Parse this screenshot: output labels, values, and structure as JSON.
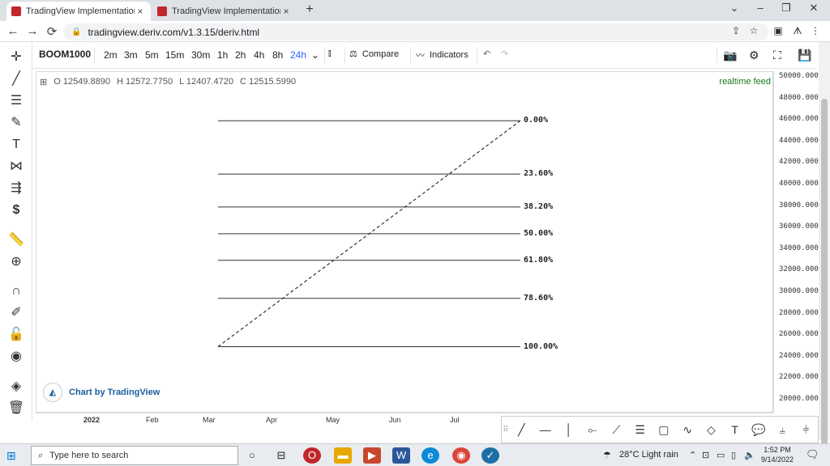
{
  "browser": {
    "tabs": [
      {
        "title": "TradingView Implementation for",
        "active": true
      },
      {
        "title": "TradingView Implementation for",
        "active": false
      }
    ],
    "url": "tradingview.deriv.com/v1.3.15/deriv.html",
    "nav": {
      "back": "←",
      "forward": "→",
      "reload": "⟳"
    }
  },
  "toolbar": {
    "symbol": "BOOM1000",
    "timeframes": [
      "2m",
      "3m",
      "5m",
      "15m",
      "30m",
      "1h",
      "2h",
      "4h",
      "8h",
      "24h"
    ],
    "active_timeframe": "24h",
    "compare_label": "Compare",
    "indicators_label": "Indicators"
  },
  "legend": {
    "o": "O 12549.8890",
    "h": "H 12572.7750",
    "l": "L 12407.4720",
    "c": "C 12515.5990",
    "feed": "realtime feed"
  },
  "branding": {
    "label": "Chart by TradingView"
  },
  "chart_data": {
    "type": "line",
    "title": "",
    "xlabel": "",
    "ylabel": "",
    "x_ticks": [
      "2022",
      "Feb",
      "Mar",
      "Apr",
      "May",
      "Jun",
      "Jul"
    ],
    "y_ticks": [
      "50000.0000",
      "48000.0000",
      "46000.0000",
      "44000.0000",
      "42000.0000",
      "40000.0000",
      "38000.0000",
      "36000.0000",
      "34000.0000",
      "32000.0000",
      "30000.0000",
      "28000.0000",
      "26000.0000",
      "24000.0000",
      "22000.0000",
      "20000.0000"
    ],
    "ylim": [
      19000,
      51000
    ],
    "grid": false,
    "fibonacci": {
      "start": {
        "x": "Mar",
        "y": 25000
      },
      "end": {
        "x": "Jul",
        "y": 46000
      },
      "levels": [
        {
          "label": "0.00%",
          "value": 46000
        },
        {
          "label": "23.60%",
          "value": 41044
        },
        {
          "label": "38.20%",
          "value": 37978
        },
        {
          "label": "50.00%",
          "value": 35500
        },
        {
          "label": "61.80%",
          "value": 33022
        },
        {
          "label": "78.60%",
          "value": 29494
        },
        {
          "label": "100.00%",
          "value": 25000
        }
      ]
    }
  },
  "taskbar": {
    "search_placeholder": "Type here to search",
    "weather": "28°C  Light rain",
    "time": "1:52 PM",
    "date": "9/14/2022"
  }
}
